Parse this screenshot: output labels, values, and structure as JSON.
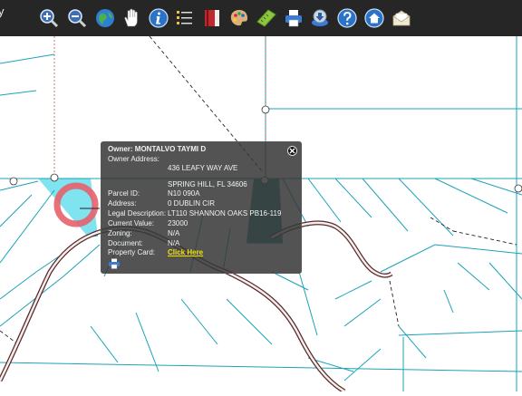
{
  "app": {
    "title_fragment": "y"
  },
  "toolbar": {
    "tools": [
      {
        "icon": "zoom-in-icon"
      },
      {
        "icon": "zoom-out-icon"
      },
      {
        "icon": "globe-icon"
      },
      {
        "icon": "pan-hand-icon"
      },
      {
        "icon": "info-icon"
      },
      {
        "icon": "list-icon"
      },
      {
        "icon": "book-icon"
      },
      {
        "icon": "palette-icon"
      },
      {
        "icon": "measure-icon"
      },
      {
        "icon": "printer-icon"
      },
      {
        "icon": "download-icon"
      },
      {
        "icon": "help-icon"
      },
      {
        "icon": "home-icon"
      },
      {
        "icon": "mail-icon"
      }
    ]
  },
  "popup": {
    "owner": "Owner: MONTALVO TAYMI D",
    "fields": {
      "owner_address_label": "Owner Address:",
      "owner_address_line1": "436 LEAFY WAY AVE",
      "owner_address_line2": "SPRING HILL, FL 34606",
      "parcel_id_label": "Parcel ID:",
      "parcel_id": "N10 090A",
      "address_label": "Address:",
      "address": "0 DUBLIN CIR",
      "legal_label": "Legal Description:",
      "legal": "LT110 SHANNON OAKS PB16-119",
      "current_value_label": "Current Value:",
      "current_value": "23000",
      "zoning_label": "Zoning:",
      "zoning": "N/A",
      "document_label": "Document:",
      "document": "N/A",
      "property_card_label": "Property Card:",
      "property_card_link": "Click Here"
    }
  },
  "colors": {
    "toolbar_bg": "#262626",
    "parcel_line": "#1aa3b8",
    "selected_parcel_fill": "#7fe3f0",
    "highlight_ring": "#e8606b",
    "road": "#5a2a2a",
    "popup_link": "#f2e400"
  }
}
